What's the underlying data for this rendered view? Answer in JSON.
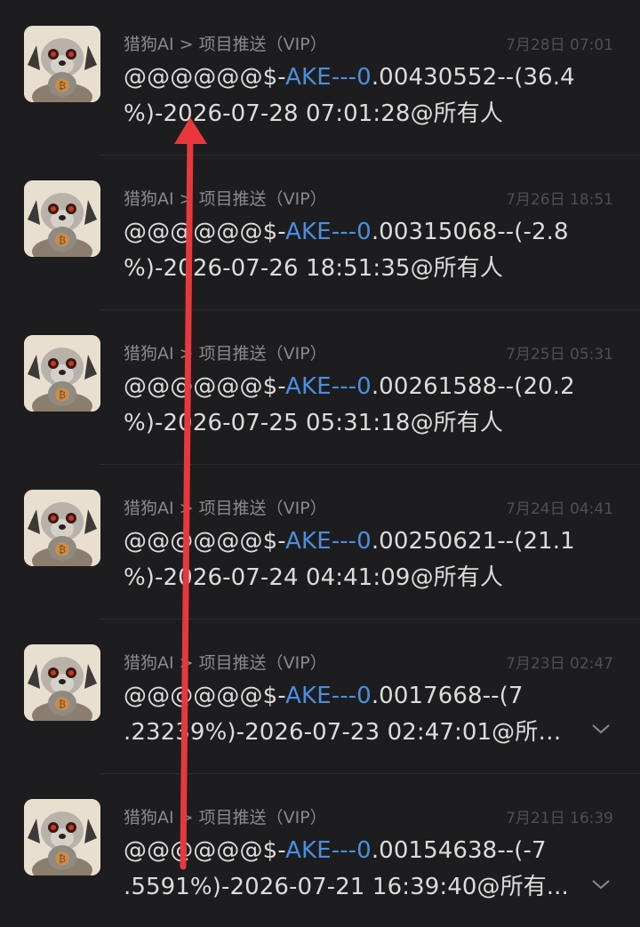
{
  "accent_color": "#4a8fe0",
  "annotation_color": "#e8383c",
  "messages": [
    {
      "source": "猎狗AI > 项目推送（VIP）",
      "time": "7月28日 07:01",
      "prefix": "@@@@@@$-",
      "token": "AKE---0",
      "line1_rest": ".00430552--(36.4",
      "line2": "%)-2026-07-28 07:01:28@所有人",
      "collapsed": false
    },
    {
      "source": "猎狗AI > 项目推送（VIP）",
      "time": "7月26日 18:51",
      "prefix": "@@@@@@$-",
      "token": "AKE---0",
      "line1_rest": ".00315068--(-2.8",
      "line2": "%)-2026-07-26 18:51:35@所有人",
      "collapsed": false
    },
    {
      "source": "猎狗AI > 项目推送（VIP）",
      "time": "7月25日 05:31",
      "prefix": "@@@@@@$-",
      "token": "AKE---0",
      "line1_rest": ".00261588--(20.2",
      "line2": "%)-2026-07-25 05:31:18@所有人",
      "collapsed": false
    },
    {
      "source": "猎狗AI > 项目推送（VIP）",
      "time": "7月24日 04:41",
      "prefix": "@@@@@@$-",
      "token": "AKE---0",
      "line1_rest": ".00250621--(21.1",
      "line2": "%)-2026-07-24 04:41:09@所有人",
      "collapsed": false
    },
    {
      "source": "猎狗AI > 项目推送（VIP）",
      "time": "7月23日 02:47",
      "prefix": "@@@@@@$-",
      "token": "AKE---0",
      "line1_rest": ".0017668--(7",
      "line2": ".23239%)-2026-07-23 02:47:01@所有...",
      "collapsed": true
    },
    {
      "source": "猎狗AI > 项目推送（VIP）",
      "time": "7月21日 16:39",
      "prefix": "@@@@@@$-",
      "token": "AKE---0",
      "line1_rest": ".00154638--(-7",
      "line2": ".5591%)-2026-07-21 16:39:40@所有...",
      "collapsed": true
    }
  ]
}
